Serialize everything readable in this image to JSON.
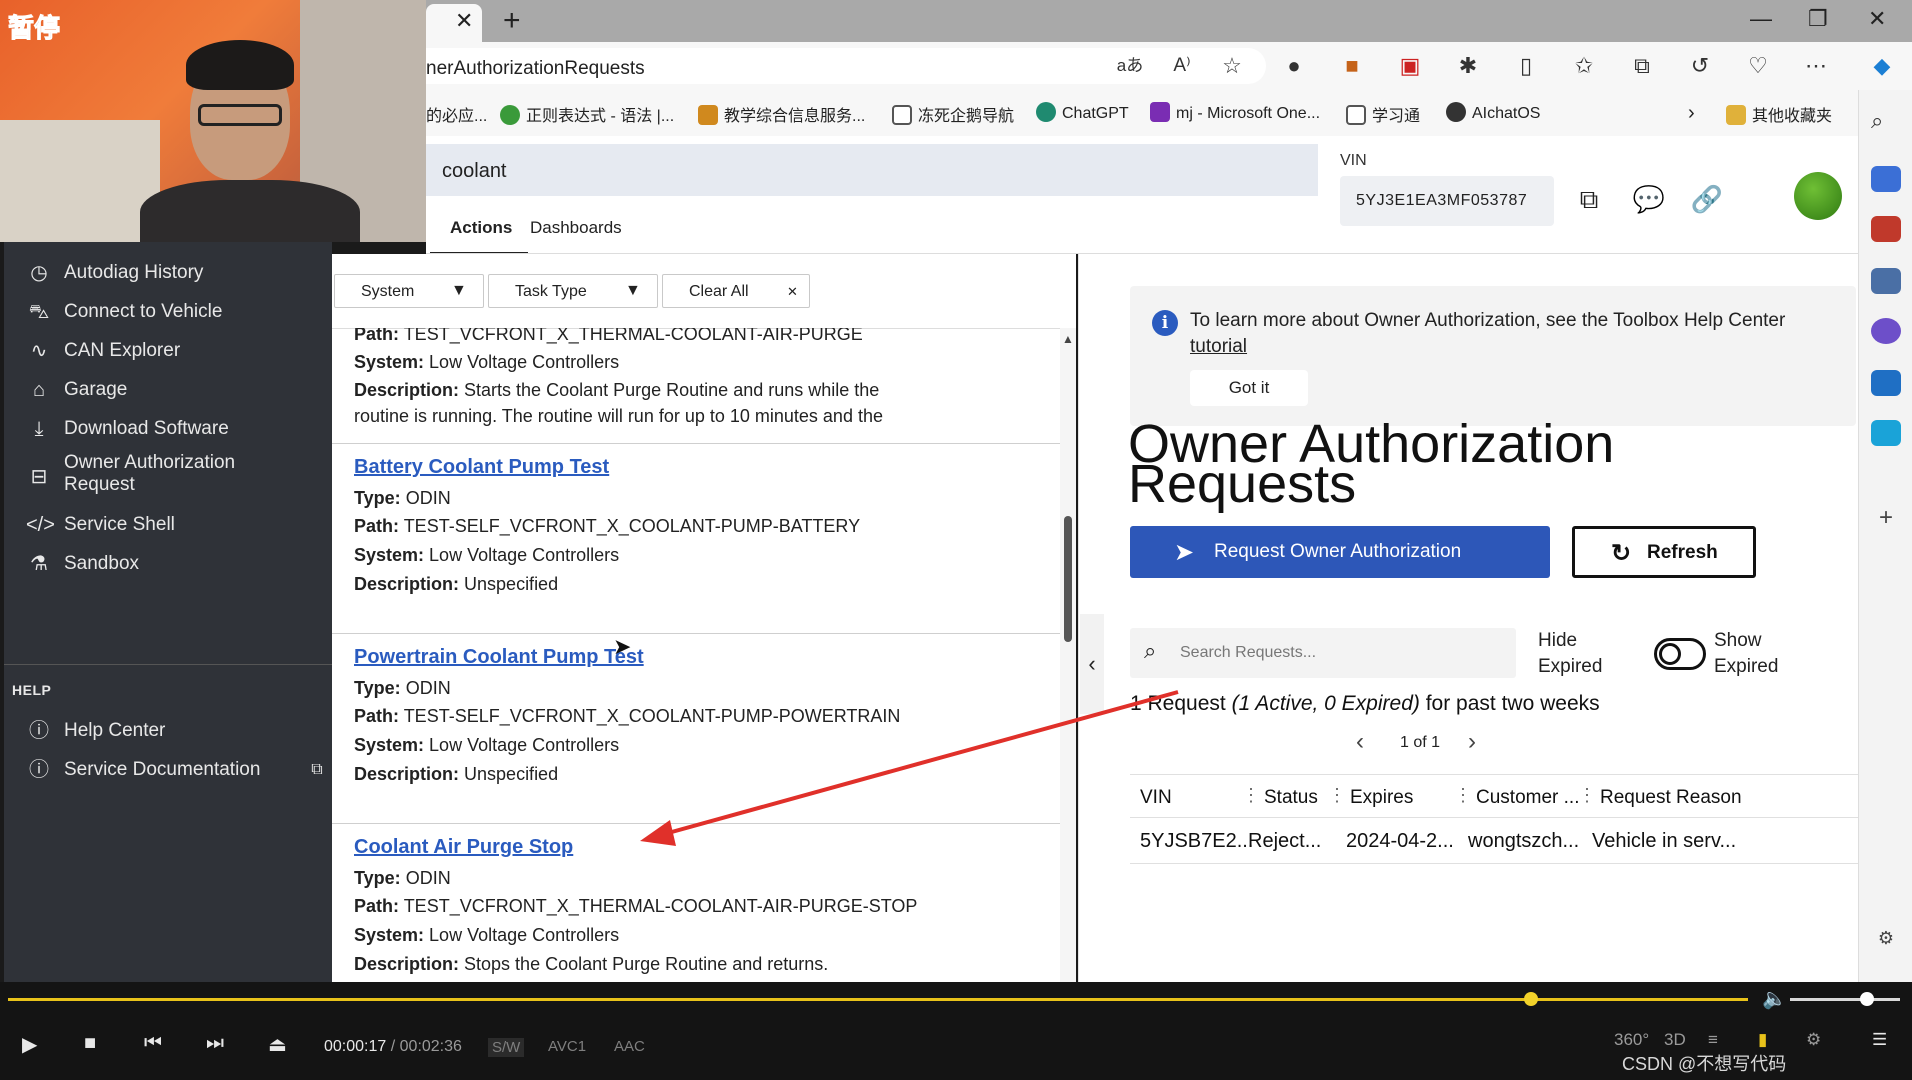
{
  "overlay": {
    "pause_label": "暂停"
  },
  "browser": {
    "url_partial": "nerAuthorizationRequests",
    "bookmarks": [
      {
        "label": "的必应...",
        "color": "#2f6fd1"
      },
      {
        "label": "正则表达式 - 语法 |...",
        "color": "#3a9a3a"
      },
      {
        "label": "教学综合信息服务...",
        "color": "#d0891e"
      },
      {
        "label": "冻死企鹅导航",
        "color": "#555555"
      },
      {
        "label": "ChatGPT",
        "color": "#1f8a70"
      },
      {
        "label": "mj - Microsoft One...",
        "color": "#7a2db3"
      },
      {
        "label": "学习通",
        "color": "#555555"
      },
      {
        "label": "AIchatOS",
        "color": "#333333"
      },
      {
        "label": "其他收藏夹",
        "color": "#e0b13a"
      }
    ]
  },
  "header": {
    "search_value": "coolant",
    "tabs": [
      "Actions",
      "Dashboards"
    ],
    "vin_label": "VIN",
    "vin_value": "5YJ3E1EA3MF053787"
  },
  "sidebar": {
    "items": [
      {
        "label": "Autodiag History",
        "icon": "history-icon"
      },
      {
        "label": "Connect to Vehicle",
        "icon": "car-icon"
      },
      {
        "label": "CAN Explorer",
        "icon": "waveform-icon"
      },
      {
        "label": "Garage",
        "icon": "home-icon"
      },
      {
        "label": "Download Software",
        "icon": "download-icon"
      },
      {
        "label": "Owner Authorization Request",
        "icon": "lock-icon"
      },
      {
        "label": "Service Shell",
        "icon": "code-icon"
      },
      {
        "label": "Sandbox",
        "icon": "sandbox-icon"
      }
    ],
    "help_heading": "HELP",
    "help_items": [
      {
        "label": "Help Center",
        "icon": "help-icon"
      },
      {
        "label": "Service Documentation",
        "icon": "info-icon"
      }
    ]
  },
  "filters": {
    "system": "System",
    "task_type": "Task Type",
    "clear_all": "Clear All"
  },
  "actions": [
    {
      "title": "",
      "path": "TEST_VCFRONT_X_THERMAL-COOLANT-AIR-PURGE",
      "system": "Low Voltage Controllers",
      "description": "Starts the Coolant Purge Routine and runs while the",
      "description2": "routine is running. The routine will run for up to 10 minutes and the"
    },
    {
      "title": "Battery Coolant Pump Test",
      "type": "ODIN",
      "path": "TEST-SELF_VCFRONT_X_COOLANT-PUMP-BATTERY",
      "system": "Low Voltage Controllers",
      "description": "Unspecified"
    },
    {
      "title": "Powertrain Coolant Pump Test",
      "type": "ODIN",
      "path": "TEST-SELF_VCFRONT_X_COOLANT-PUMP-POWERTRAIN",
      "system": "Low Voltage Controllers",
      "description": "Unspecified"
    },
    {
      "title": "Coolant Air Purge Stop",
      "type": "ODIN",
      "path": "TEST_VCFRONT_X_THERMAL-COOLANT-AIR-PURGE-STOP",
      "system": "Low Voltage Controllers",
      "description": "Stops the Coolant Purge Routine and returns."
    }
  ],
  "labels": {
    "type": "Type:",
    "path": "Path:",
    "system": "System:",
    "description": "Description:"
  },
  "owner_auth": {
    "info_text": "To learn more about Owner Authorization, see the Toolbox Help Center",
    "info_link": "tutorial",
    "got_it": "Got it",
    "title_line1": "Owner Authorization",
    "title_line2": "Requests",
    "request_button": "Request Owner Authorization",
    "refresh_button": "Refresh",
    "search_placeholder": "Search Requests...",
    "hide_expired": "Hide Expired",
    "show_expired": "Show Expired",
    "summary_count": "1 Request",
    "summary_detail": "(1 Active, 0 Expired)",
    "summary_suffix": "for past two weeks",
    "pager_text": "1 of 1",
    "table": {
      "headers": [
        "VIN",
        "Status",
        "Expires",
        "Customer ...",
        "Request Reason"
      ],
      "rows": [
        [
          "5YJSB7E2...",
          "Reject...",
          "2024-04-2...",
          "wongtszch...",
          "Vehicle in serv..."
        ]
      ]
    }
  },
  "player": {
    "current_time": "00:00:17",
    "separator": "/",
    "duration": "00:02:36",
    "tags": [
      "S/W",
      "AVC1",
      "AAC"
    ],
    "progress": 0.875,
    "volume": 0.7,
    "right_labels": [
      "360°",
      "3D"
    ],
    "watermark": "CSDN @不想写代码"
  },
  "colors": {
    "accent_blue": "#2d57b8",
    "link_blue": "#2a5bbf",
    "nav_bg": "#2f3238",
    "annotation_red": "#e0302a",
    "progress_yellow": "#e8c21a"
  }
}
